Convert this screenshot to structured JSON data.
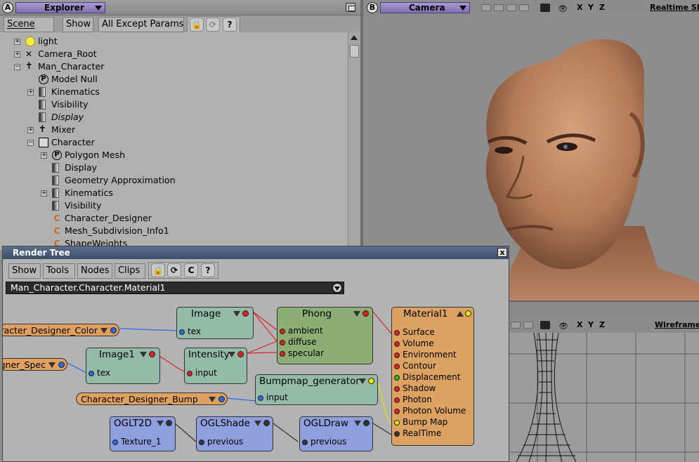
{
  "explorer": {
    "letter": "A",
    "title": "Explorer",
    "toolbar": {
      "scene": "Scene",
      "show": "Show",
      "filter": "All Except Params"
    },
    "tree": [
      {
        "label": "light",
        "depth": 0,
        "toggle": "+",
        "icon": "light-icon"
      },
      {
        "label": "Camera_Root",
        "depth": 0,
        "toggle": "+",
        "icon": "camera-root-icon"
      },
      {
        "label": "Man_Character",
        "depth": 0,
        "toggle": "−",
        "icon": "character-icon"
      },
      {
        "label": "Model Null",
        "depth": 1,
        "toggle": "",
        "icon": "primitive-icon"
      },
      {
        "label": "Kinematics",
        "depth": 1,
        "toggle": "+",
        "icon": "property-icon"
      },
      {
        "label": "Visibility",
        "depth": 1,
        "toggle": "",
        "icon": "property-icon"
      },
      {
        "label": "Display",
        "depth": 1,
        "toggle": "",
        "icon": "property-icon",
        "italic": true
      },
      {
        "label": "Mixer",
        "depth": 1,
        "toggle": "+",
        "icon": "mixer-icon"
      },
      {
        "label": "Character",
        "depth": 1,
        "toggle": "−",
        "icon": "model-icon"
      },
      {
        "label": "Polygon Mesh",
        "depth": 2,
        "toggle": "+",
        "icon": "primitive-icon"
      },
      {
        "label": "Display",
        "depth": 2,
        "toggle": "",
        "icon": "property-icon"
      },
      {
        "label": "Geometry Approximation",
        "depth": 2,
        "toggle": "",
        "icon": "property-icon"
      },
      {
        "label": "Kinematics",
        "depth": 2,
        "toggle": "+",
        "icon": "property-icon"
      },
      {
        "label": "Visibility",
        "depth": 2,
        "toggle": "",
        "icon": "property-icon"
      },
      {
        "label": "Character_Designer",
        "depth": 2,
        "toggle": "",
        "icon": "custom-param-icon"
      },
      {
        "label": "Mesh_Subdivision_Info1",
        "depth": 2,
        "toggle": "",
        "icon": "custom-param-icon"
      },
      {
        "label": "ShapeWeights",
        "depth": 2,
        "toggle": "",
        "icon": "custom-param-icon"
      }
    ]
  },
  "viewport_b": {
    "letter": "B",
    "view": "Camera",
    "axes": [
      "X",
      "Y",
      "Z"
    ],
    "mode": "Realtime Sh..."
  },
  "viewport_d": {
    "axes": [
      "X",
      "Y",
      "Z"
    ],
    "mode": "Wireframe"
  },
  "render_tree": {
    "title": "Render Tree",
    "close": "x",
    "menus": {
      "show": "Show",
      "tools": "Tools",
      "nodes": "Nodes",
      "clips": "Clips"
    },
    "path": "Man_Character.Character.Material1",
    "nodes": {
      "image": {
        "title": "Image",
        "ports": [
          "tex"
        ]
      },
      "intensity": {
        "title": "Intensity",
        "ports": [
          "input"
        ]
      },
      "image1": {
        "title": "Image1",
        "ports": [
          "tex"
        ]
      },
      "phong": {
        "title": "Phong",
        "ports": [
          "ambient",
          "diffuse",
          "specular"
        ]
      },
      "material1": {
        "title": "Material1",
        "ports": [
          "Surface",
          "Volume",
          "Environment",
          "Contour",
          "Displacement",
          "Shadow",
          "Photon",
          "Photon Volume",
          "Bump Map",
          "RealTime"
        ]
      },
      "bumpmap": {
        "title": "Bumpmap_generator",
        "ports": [
          "input"
        ]
      },
      "ogl2d": {
        "title": "OGLT2D",
        "ports": [
          "Texture_1"
        ]
      },
      "oglshade": {
        "title": "OGLShade",
        "ports": [
          "previous"
        ]
      },
      "ogldraw": {
        "title": "OGLDraw",
        "ports": [
          "previous"
        ]
      },
      "color_param": {
        "title": "Character_Designer_Color"
      },
      "spec_param": {
        "title": "Character_Designer_Spec"
      },
      "bump_param": {
        "title": "Character_Designer_Bump"
      }
    }
  },
  "colors": {
    "node_green": "#94bba8",
    "node_olive": "#8cad73",
    "node_orange": "#dca262",
    "node_blue": "#8f9fde",
    "param_orange": "#e0a060"
  }
}
